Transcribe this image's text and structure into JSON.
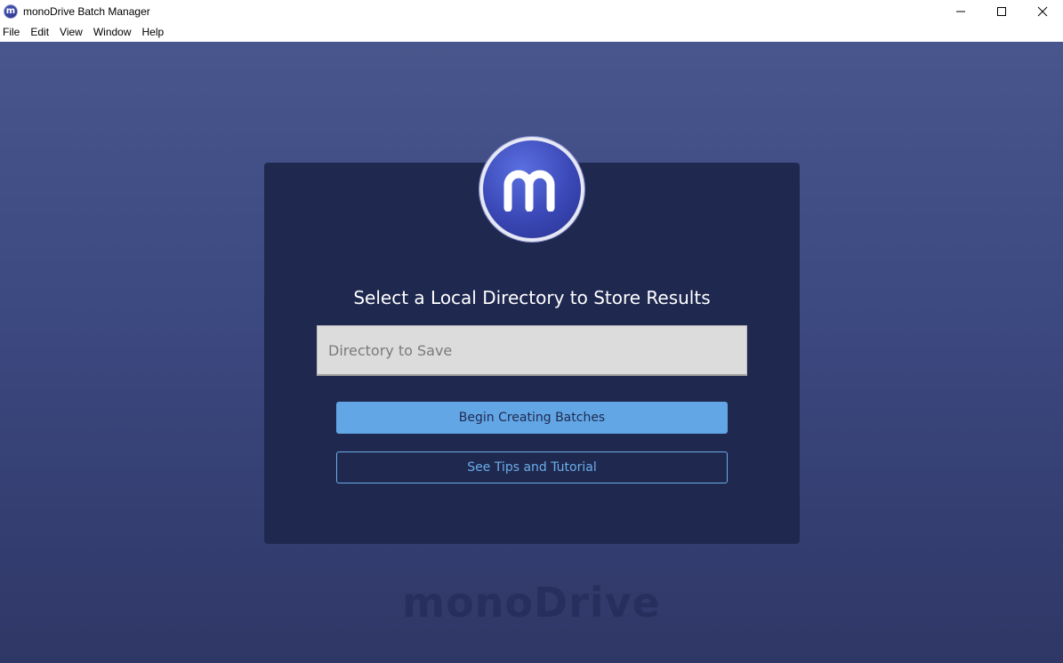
{
  "window": {
    "title": "monoDrive Batch Manager",
    "app_icon_letter": "m",
    "controls": [
      "minimize-icon",
      "maximize-icon",
      "close-icon"
    ]
  },
  "menu": {
    "items": [
      "File",
      "Edit",
      "View",
      "Window",
      "Help"
    ]
  },
  "main": {
    "logo_letter": "m",
    "heading": "Select a Local Directory to Store Results",
    "directory_input": {
      "placeholder": "Directory to Save",
      "value": ""
    },
    "primary_button": "Begin Creating Batches",
    "secondary_button": "See Tips and Tutorial",
    "watermark": "monoDrive"
  },
  "colors": {
    "card_background": "#1f284f",
    "primary_button": "#62a6e6",
    "secondary_button_border": "#6aaee8",
    "background_top": "#48568d",
    "background_bottom": "#2f3766"
  }
}
